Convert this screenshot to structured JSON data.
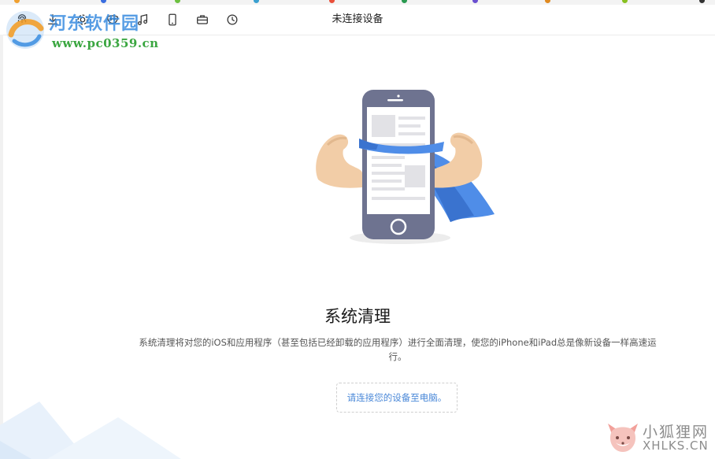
{
  "toolbar": {
    "title": "未连接设备",
    "icons": [
      "fingerprint-icon",
      "download-icon",
      "gear-icon",
      "mask-icon",
      "music-icon",
      "phone-icon",
      "briefcase-icon",
      "history-icon"
    ]
  },
  "watermark_top": {
    "brand": "河东软件园",
    "url": "www.pc0359.cn"
  },
  "main": {
    "heading": "系统清理",
    "description": "系统清理将对您的iOS和应用程序（甚至包括已经卸载的应用程序）进行全面清理，使您的iPhone和iPad总是像新设备一样高速运行。",
    "connect_hint": "请连接您的设备至电脑。"
  },
  "watermark_bottom": {
    "cn": "小狐狸网",
    "en": "XHLKS.CN"
  },
  "colors": {
    "accent": "#4a88d8",
    "cape": "#4f8de8",
    "phone": "#6e7390",
    "arm": "#f2cda7"
  }
}
